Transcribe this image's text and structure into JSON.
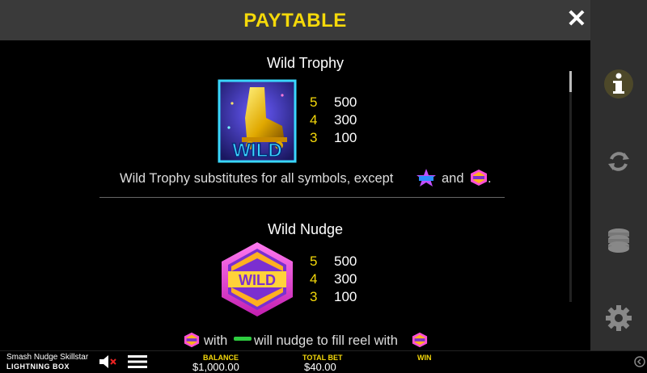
{
  "header": {
    "title": "PAYTABLE",
    "close_icon": "close-icon"
  },
  "sidebar": {
    "icons": [
      "info-icon",
      "autoplay-icon",
      "coins-stack-icon",
      "gear-icon"
    ],
    "active_color": "#f5d90a"
  },
  "sections": [
    {
      "title": "Wild Trophy",
      "symbol": "wild-trophy-symbol",
      "symbol_text": "WILD",
      "pays": [
        {
          "count": "5",
          "value": "500"
        },
        {
          "count": "4",
          "value": "300"
        },
        {
          "count": "3",
          "value": "100"
        }
      ],
      "desc_before": "Wild Trophy substitutes for all symbols, except",
      "desc_and": "and",
      "desc_end": "."
    },
    {
      "title": "Wild Nudge",
      "symbol": "wild-nudge-symbol",
      "symbol_text": "WILD",
      "pays": [
        {
          "count": "5",
          "value": "500"
        },
        {
          "count": "4",
          "value": "300"
        },
        {
          "count": "3",
          "value": "100"
        }
      ],
      "desc_with": "with",
      "desc_rest": "will nudge to fill reel with"
    }
  ],
  "footer": {
    "game_name": "Smash Nudge Skillstar",
    "provider_logo": "LIGHTNING BOX",
    "balance_label": "BALANCE",
    "balance_value": "$1,000.00",
    "total_bet_label": "TOTAL BET",
    "total_bet_value": "$40.00",
    "win_label": "WIN"
  },
  "colors": {
    "accent": "#f5d90a",
    "header_bg": "#3a3a3a",
    "sidebar_bg": "#2f2f2f",
    "symbol_purple": "#7b2fd0",
    "symbol_pink": "#ff4fd8"
  }
}
